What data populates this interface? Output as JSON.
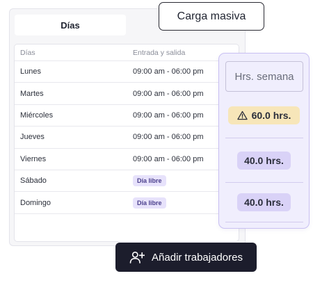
{
  "tabs": {
    "active_label": "Días"
  },
  "bulk_upload": {
    "label": "Carga masiva"
  },
  "table": {
    "headers": {
      "day": "Días",
      "hours": "Entrada y salida"
    },
    "rows": [
      {
        "day": "Lunes",
        "hours": "09:00 am - 06:00 pm"
      },
      {
        "day": "Martes",
        "hours": "09:00 am - 06:00 pm"
      },
      {
        "day": "Miércoles",
        "hours": "09:00 am - 06:00 pm"
      },
      {
        "day": "Jueves",
        "hours": "09:00 am - 06:00 pm"
      },
      {
        "day": "Viernes",
        "hours": "09:00 am - 06:00 pm"
      },
      {
        "day": "Sábado",
        "badge": "Día libre"
      },
      {
        "day": "Domingo",
        "badge": "Día libre"
      }
    ]
  },
  "weekly_hours": {
    "header": "Hrs. semana",
    "entries": [
      {
        "value": "60.0 hrs.",
        "status": "warning",
        "icon": "warning-triangle-icon",
        "color": "#f7e6b9"
      },
      {
        "value": "40.0 hrs.",
        "status": "ok",
        "color": "#d9d2f7"
      },
      {
        "value": "40.0 hrs.",
        "status": "ok",
        "color": "#d9d2f7"
      }
    ]
  },
  "add_workers": {
    "label": "Añadir trabajadores",
    "icon": "add-user-icon"
  }
}
